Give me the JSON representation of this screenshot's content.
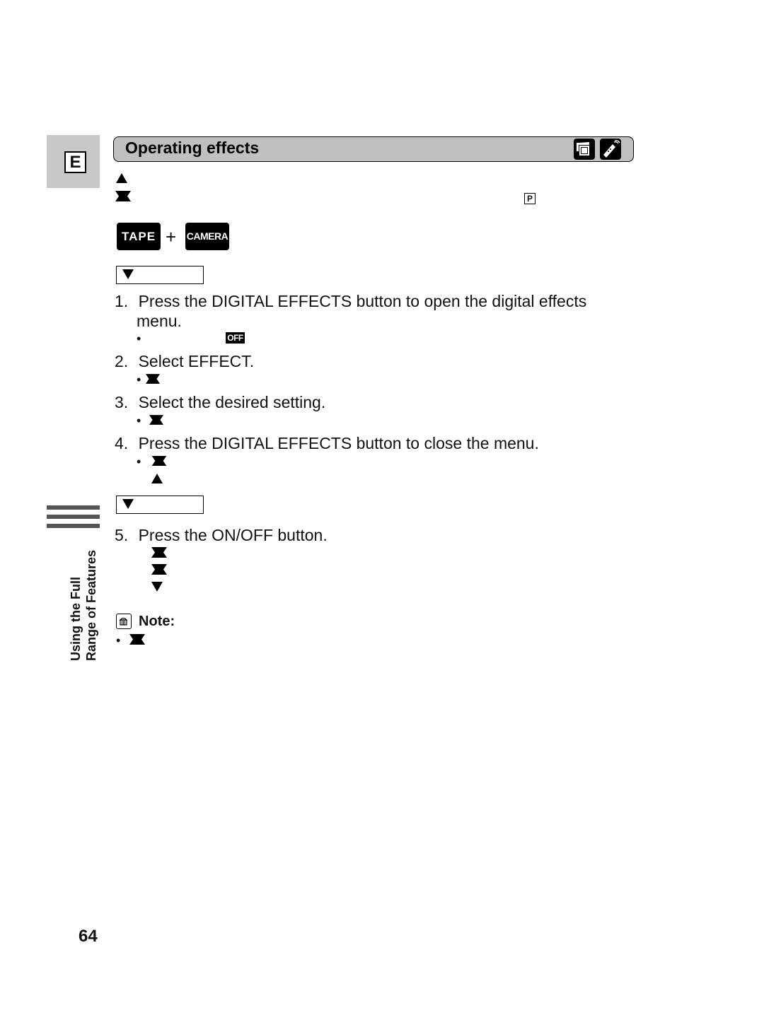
{
  "page": {
    "language_tab": "E",
    "section_title": "Operating effects",
    "header_icons": [
      "camcorder-icon",
      "remote-control-icon"
    ],
    "program_mode_badge": "P",
    "mode_badges": {
      "tape": "TAPE",
      "plus": "+",
      "camera": "CAMERA"
    },
    "steps": [
      {
        "number": "1.",
        "text": "Press the DIGITAL EFFECTS button to open the digital effects",
        "continuation": "menu."
      },
      {
        "number": "2.",
        "text": "Select EFFECT."
      },
      {
        "number": "3.",
        "text": "Select the desired setting."
      },
      {
        "number": "4.",
        "text": "Press the DIGITAL EFFECTS button to close the menu."
      },
      {
        "number": "5.",
        "text": "Press the ON/OFF button."
      }
    ],
    "off_badge": "OFF",
    "bullet": "•",
    "note_label": "Note:",
    "side_label": {
      "line1": "Using the Full",
      "line2": "Range of Features"
    },
    "page_number": "64"
  }
}
